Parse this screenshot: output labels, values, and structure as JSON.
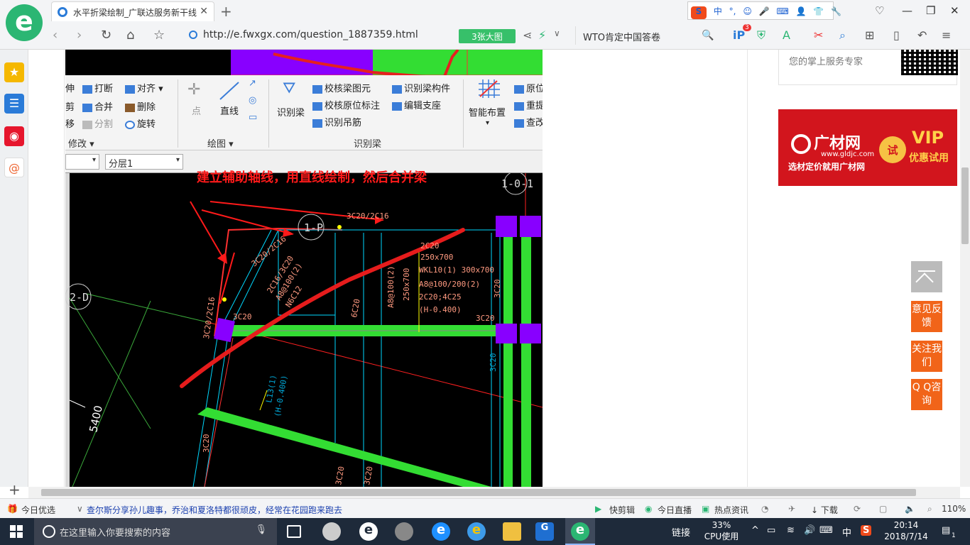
{
  "browser": {
    "tab_title": "水平折梁绘制_广联达服务新干线",
    "tab_close": "✕",
    "new_tab": "+",
    "url": "http://e.fwxgx.com/question_1887359.html",
    "image_count": "3张大图",
    "search_text": "WTO肯定中国答卷",
    "ime": {
      "label_zh": "中",
      "punct": "°,"
    },
    "window_buttons": {
      "minimize": "—",
      "restore": "❐",
      "close": "✕"
    },
    "nav": {
      "back": "‹",
      "forward": "›",
      "refresh": "↻",
      "home": "⌂",
      "favorite": "☆"
    },
    "badge_count": "3"
  },
  "ribbon": {
    "modify_items": [
      "伸",
      "剪",
      "移"
    ],
    "edit_items": [
      "打断",
      "合并",
      "分割"
    ],
    "edit_items2": [
      "对齐",
      "删除",
      "旋转"
    ],
    "group_modify": "修改",
    "draw_items": [
      "点",
      "直线"
    ],
    "group_draw": "绘图",
    "recognize_items": [
      "识别梁"
    ],
    "check_items": [
      "校核梁图元",
      "校核原位标注",
      "识别吊筋"
    ],
    "check_items2": [
      "识别梁构件",
      "编辑支座"
    ],
    "group_recognize": "识别梁",
    "smart_layout": "智能布置",
    "right_items": [
      "原位",
      "重提",
      "查改"
    ]
  },
  "layer_select": {
    "value": "分层1"
  },
  "cad": {
    "annotation": "建立辅助轴线，用直线绘制，然后合并梁",
    "axis_labels": [
      "1-P",
      "2-D",
      "1-0-1"
    ],
    "dimension": "5400",
    "beam_texts": [
      "3C20/2C16",
      "3C20/2C16",
      "3C20/2C16",
      "2C16/3C20",
      "A8@100(2)",
      "N6C12",
      "6C20",
      "A8@100(2)",
      "250x700",
      "3C20",
      "3C20",
      "3C20",
      "WKL10(1) 300x700",
      "A8@100/200(2)",
      "2C20;4C25",
      "(H-0.400)",
      "3C20",
      "L13(1)",
      "(H-0.400)",
      "3C20",
      "3C20",
      "3C20",
      "2C20",
      "250x700"
    ]
  },
  "right_col": {
    "qr_text": "您的掌上服务专家",
    "ad": {
      "brand": "广材网",
      "url": "www.gldjc.com",
      "tagline": "选材定价就用广材网",
      "try": "试",
      "vip": "VIP",
      "vip_sub": "优惠试用"
    }
  },
  "float_buttons": [
    "意见反馈",
    "关注我们",
    "Q Q咨询"
  ],
  "status_bar": {
    "today_pick": "今日优选",
    "news": "查尔斯分享孙儿趣事，乔治和夏洛特都很顽皮，经常在花园跑来跑去",
    "quick_cut": "快剪辑",
    "live": "今日直播",
    "hot_news": "热点资讯",
    "download": "下载",
    "zoom": "110%"
  },
  "taskbar": {
    "search_placeholder": "在这里输入你要搜索的内容",
    "link_label": "链接",
    "cpu_percent": "33%",
    "cpu_label": "CPU使用",
    "ime": "中",
    "time": "20:14",
    "date": "2018/7/14",
    "notif_count": "1"
  },
  "colors": {
    "beam_green": "#33dd33",
    "column_purple": "#8800ff",
    "line_cyan": "#00d8ff",
    "annotation_red": "#ff1a1a",
    "text_salmon": "#ff9a80"
  }
}
